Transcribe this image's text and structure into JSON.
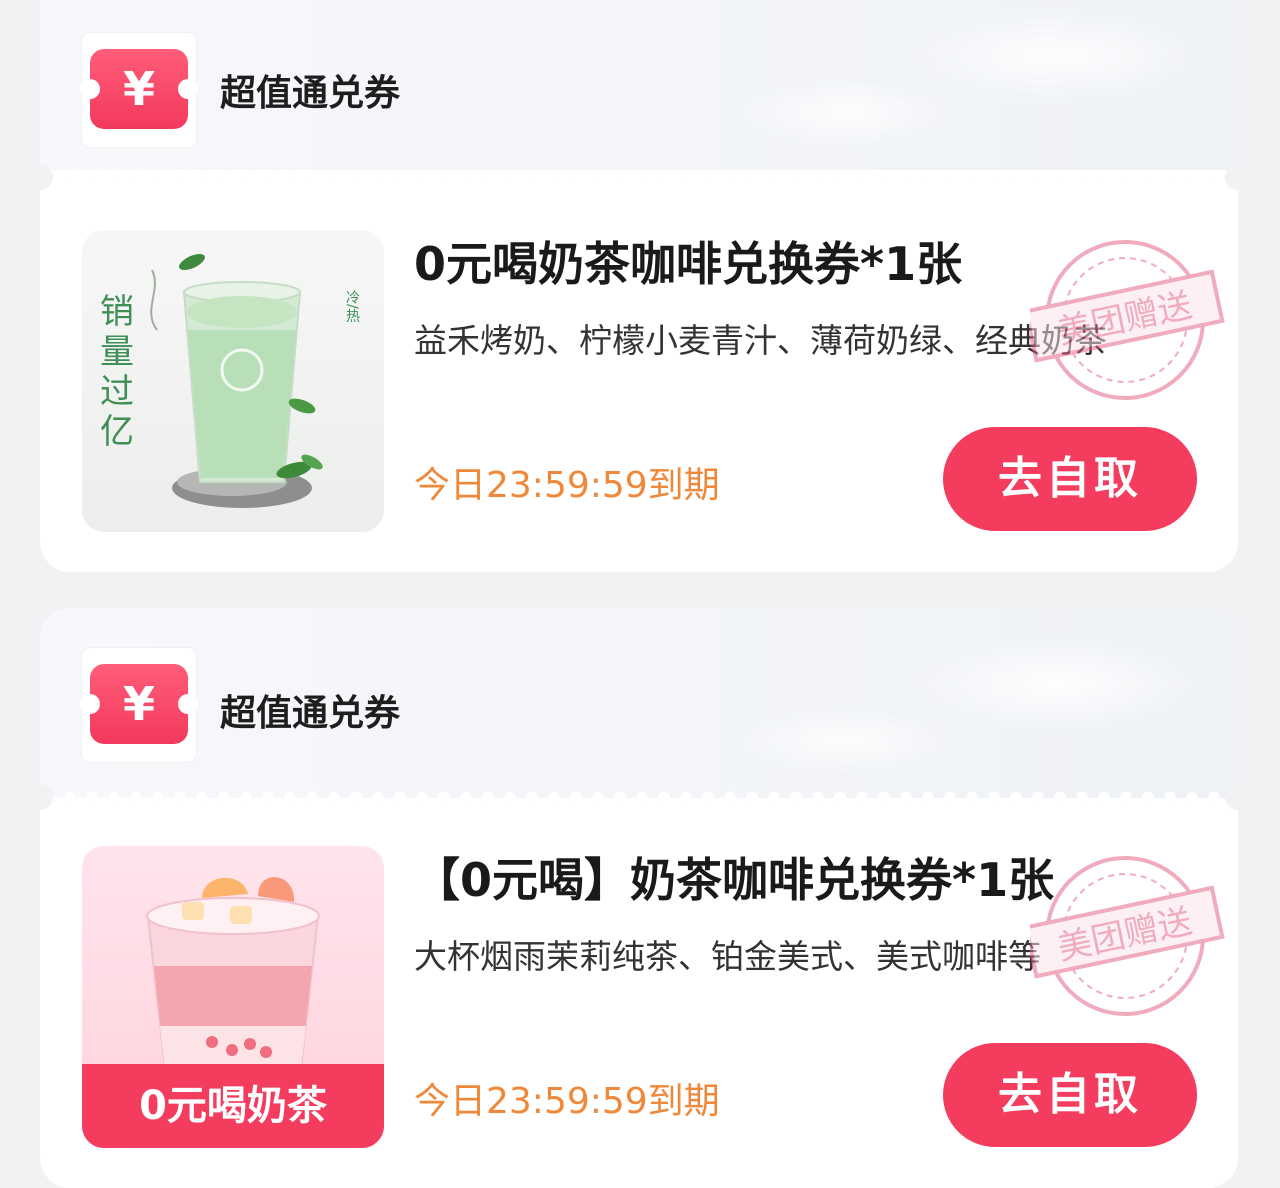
{
  "coupons": [
    {
      "header_title": "超值通兑券",
      "logo_symbol": "¥",
      "title": "0元喝奶茶咖啡兑换券*1张",
      "description": "益禾烤奶、柠檬小麦青汁、薄荷奶绿、经典奶茶",
      "expiry": "今日23:59:59到期",
      "cta": "去自取",
      "stamp_text": "美团赠送",
      "image": {
        "vertical_text": [
          "销",
          "量",
          "过",
          "亿"
        ],
        "temp_label": "冷/热",
        "drink_color": "#b8dfb8"
      }
    },
    {
      "header_title": "超值通兑券",
      "logo_symbol": "¥",
      "title": "【0元喝】奶茶咖啡兑换券*1张",
      "description": "大杯烟雨茉莉纯茶、铂金美式、美式咖啡等",
      "expiry": "今日23:59:59到期",
      "cta": "去自取",
      "stamp_text": "美团赠送",
      "image": {
        "banner": "0元喝奶茶",
        "drink_color": "#f7a8a8"
      }
    }
  ],
  "colors": {
    "accent": "#f43c5f",
    "expiry": "#f0883a"
  }
}
